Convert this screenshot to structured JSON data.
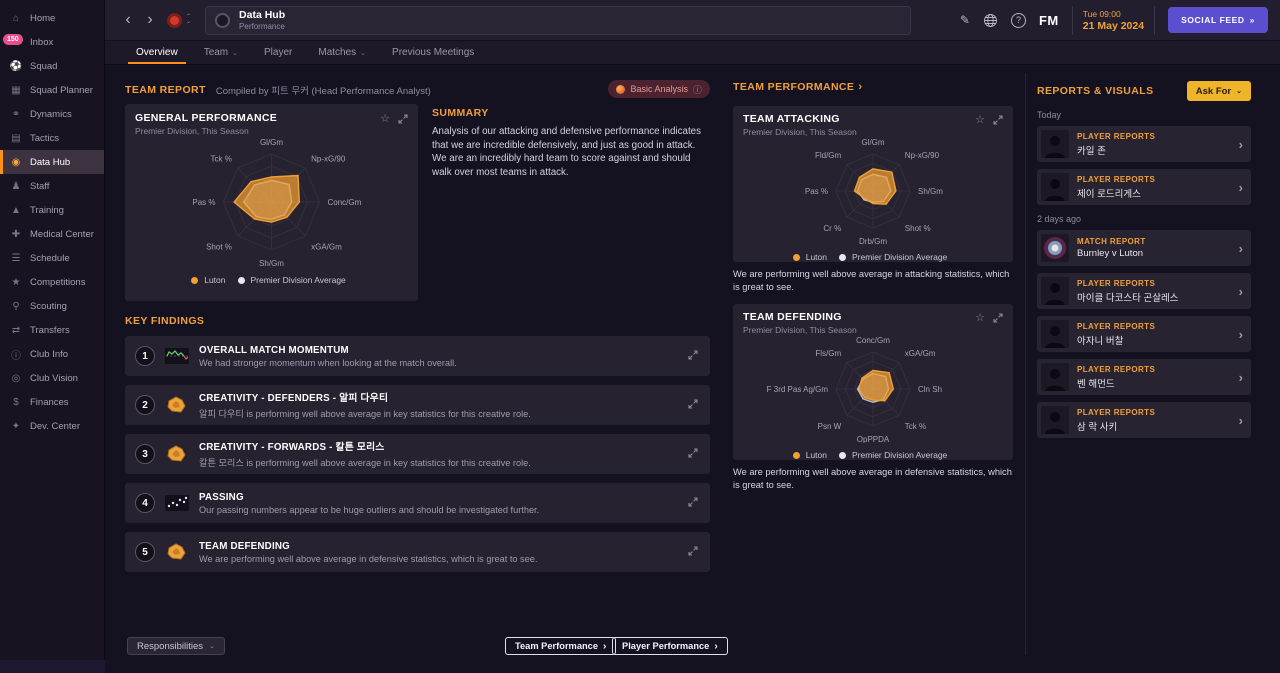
{
  "icons": {
    "back": "‹",
    "forward": "›",
    "caret_down": "⌄",
    "caret_up": "⌃",
    "chevron_right": "›",
    "star": "☆",
    "info": "ⓘ",
    "pencil": "✎",
    "help": "?",
    "social_feed_chevron": "»"
  },
  "header": {
    "title": "Data Hub",
    "subtitle": "Performance",
    "date_time": "Tue 09:00",
    "date": "21 May 2024",
    "fm_logo": "FM",
    "social_feed_label": "SOCIAL FEED"
  },
  "sidebar": {
    "items": [
      {
        "id": "home",
        "label": "Home",
        "glyph": "⌂"
      },
      {
        "id": "inbox",
        "label": "Inbox",
        "glyph": "✉",
        "badge": "150"
      },
      {
        "id": "squad",
        "label": "Squad",
        "glyph": "⚽"
      },
      {
        "id": "squad-planner",
        "label": "Squad Planner",
        "glyph": "▦"
      },
      {
        "id": "dynamics",
        "label": "Dynamics",
        "glyph": "⚭"
      },
      {
        "id": "tactics",
        "label": "Tactics",
        "glyph": "▤"
      },
      {
        "id": "data-hub",
        "label": "Data Hub",
        "glyph": "◉",
        "selected": true
      },
      {
        "id": "staff",
        "label": "Staff",
        "glyph": "♟"
      },
      {
        "id": "training",
        "label": "Training",
        "glyph": "▲"
      },
      {
        "id": "medical-center",
        "label": "Medical Center",
        "glyph": "✚"
      },
      {
        "id": "schedule",
        "label": "Schedule",
        "glyph": "☰"
      },
      {
        "id": "competitions",
        "label": "Competitions",
        "glyph": "★"
      },
      {
        "id": "scouting",
        "label": "Scouting",
        "glyph": "⚲"
      },
      {
        "id": "transfers",
        "label": "Transfers",
        "glyph": "⇄"
      },
      {
        "id": "club-info",
        "label": "Club Info",
        "glyph": "ⓘ"
      },
      {
        "id": "club-vision",
        "label": "Club Vision",
        "glyph": "◎"
      },
      {
        "id": "finances",
        "label": "Finances",
        "glyph": "$"
      },
      {
        "id": "dev-center",
        "label": "Dev. Center",
        "glyph": "✦"
      }
    ]
  },
  "tabs": [
    {
      "id": "overview",
      "label": "Overview",
      "selected": true
    },
    {
      "id": "team",
      "label": "Team",
      "dropdown": true
    },
    {
      "id": "player",
      "label": "Player"
    },
    {
      "id": "matches",
      "label": "Matches",
      "dropdown": true
    },
    {
      "id": "previous-meetings",
      "label": "Previous Meetings"
    }
  ],
  "team_report": {
    "title": "TEAM REPORT",
    "compiled_by": "Compiled by 피트 무커 (Head Performance Analyst)",
    "basic_analysis_label": "Basic Analysis"
  },
  "general_performance": {
    "title": "GENERAL PERFORMANCE",
    "subtitle": "Premier Division, This Season"
  },
  "summary": {
    "title": "SUMMARY",
    "text": "Analysis of our attacking and defensive performance indicates that we are incredible defensively, and just as good in attack. We are an incredibly hard team to score against and should walk over most teams in attack."
  },
  "key_findings": {
    "title": "KEY FINDINGS",
    "items": [
      {
        "num": "1",
        "icon": "momentum",
        "title": "OVERALL MATCH MOMENTUM",
        "desc": "We had stronger momentum when looking at the match overall."
      },
      {
        "num": "2",
        "icon": "radar",
        "title": "CREATIVITY - DEFENDERS - 알피 다우티",
        "desc": "알피 다우티 is performing well above average in key statistics for this creative role."
      },
      {
        "num": "3",
        "icon": "radar",
        "title": "CREATIVITY - FORWARDS - 칼튼 모리스",
        "desc": "칼튼 모리스 is performing well above average in key statistics for this creative role."
      },
      {
        "num": "4",
        "icon": "scatter",
        "title": "PASSING",
        "desc": "Our passing numbers appear to be huge outliers and should be investigated further."
      },
      {
        "num": "5",
        "icon": "radar",
        "title": "TEAM DEFENDING",
        "desc": "We are performing well above average in defensive statistics, which is great to see."
      }
    ]
  },
  "team_performance": {
    "title": "TEAM PERFORMANCE",
    "attacking": {
      "title": "TEAM ATTACKING",
      "subtitle": "Premier Division, This Season",
      "desc": "We are performing well above average in attacking statistics, which is great to see."
    },
    "defending": {
      "title": "TEAM DEFENDING",
      "subtitle": "Premier Division, This Season",
      "desc": "We are performing well above average in defensive statistics, which is great to see."
    }
  },
  "reports": {
    "title": "REPORTS & VISUALS",
    "ask_for_label": "Ask For",
    "groups": [
      {
        "label": "Today",
        "items": [
          {
            "type": "player",
            "category": "PLAYER REPORTS",
            "name": "카일 존"
          },
          {
            "type": "player",
            "category": "PLAYER REPORTS",
            "name": "제이 로드리게스"
          }
        ]
      },
      {
        "label": "2 days ago",
        "items": [
          {
            "type": "match",
            "category": "MATCH REPORT",
            "name": "Burnley v Luton"
          },
          {
            "type": "player",
            "category": "PLAYER REPORTS",
            "name": "마이클 다코스타 곤살레스"
          },
          {
            "type": "player",
            "category": "PLAYER REPORTS",
            "name": "아자니 버찰"
          },
          {
            "type": "player",
            "category": "PLAYER REPORTS",
            "name": "벤 해먼드"
          },
          {
            "type": "player",
            "category": "PLAYER REPORTS",
            "name": "삼 락 사키"
          }
        ]
      }
    ]
  },
  "footer": {
    "responsibilities_label": "Responsibilities",
    "team_performance_label": "Team Performance",
    "player_performance_label": "Player Performance"
  },
  "colors": {
    "accent_orange": "#f0a13c",
    "selected_orange": "#ff9018",
    "social_feed_purple": "#5b4fd0",
    "ask_for_yellow": "#f0b428",
    "panel_bg": "#26222f",
    "page_bg": "#141121",
    "radar_team": "#f2a032",
    "radar_average": "#e8e6ee"
  },
  "chart_data": [
    {
      "id": "general",
      "type": "radar",
      "title": "GENERAL PERFORMANCE",
      "subtitle": "Premier Division, This Season",
      "labels": [
        "Gl/Gm",
        "Np-xG/90",
        "Conc/Gm",
        "xGA/Gm",
        "Sh/Gm",
        "Shot %",
        "Pas %",
        "Tck %"
      ],
      "scale": [
        0,
        1
      ],
      "series": [
        {
          "name": "Luton",
          "values": [
            0.52,
            0.78,
            0.58,
            0.45,
            0.42,
            0.5,
            0.78,
            0.6
          ]
        },
        {
          "name": "Premier Division Average",
          "values": [
            0.45,
            0.52,
            0.42,
            0.38,
            0.36,
            0.44,
            0.58,
            0.5
          ]
        }
      ]
    },
    {
      "id": "attacking",
      "type": "radar",
      "title": "TEAM ATTACKING",
      "subtitle": "Premier Division, This Season",
      "labels": [
        "Gl/Gm",
        "Np-xG/90",
        "Sh/Gm",
        "Shot %",
        "Drb/Gm",
        "Cr %",
        "Pas %",
        "Fld/Gm"
      ],
      "scale": [
        0,
        1
      ],
      "series": [
        {
          "name": "Luton",
          "values": [
            0.6,
            0.72,
            0.62,
            0.5,
            0.34,
            0.3,
            0.5,
            0.52
          ]
        },
        {
          "name": "Premier Division Average",
          "values": [
            0.45,
            0.52,
            0.48,
            0.4,
            0.3,
            0.34,
            0.42,
            0.44
          ]
        }
      ]
    },
    {
      "id": "defending",
      "type": "radar",
      "title": "TEAM DEFENDING",
      "subtitle": "Premier Division, This Season",
      "labels": [
        "Conc/Gm",
        "xGA/Gm",
        "Cln Sh",
        "Tck %",
        "OpPPDA",
        "Psn W",
        "F 3rd Pas Ag/Gm",
        "Fls/Gm"
      ],
      "scale": [
        0,
        1
      ],
      "series": [
        {
          "name": "Luton",
          "values": [
            0.5,
            0.62,
            0.55,
            0.45,
            0.3,
            0.32,
            0.38,
            0.42
          ]
        },
        {
          "name": "Premier Division Average",
          "values": [
            0.42,
            0.48,
            0.42,
            0.4,
            0.36,
            0.38,
            0.42,
            0.38
          ]
        }
      ]
    }
  ]
}
